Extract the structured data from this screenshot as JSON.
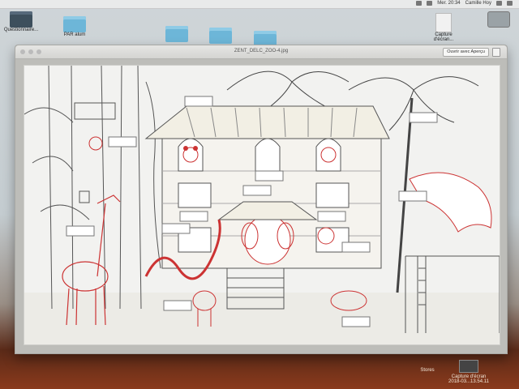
{
  "menubar": {
    "time": "Mer. 20:34",
    "user": "Camille Hoy"
  },
  "desktop": {
    "icons": [
      {
        "label": "Questionnaire..."
      },
      {
        "label": "PAR alum"
      },
      {
        "label": ""
      },
      {
        "label": ""
      },
      {
        "label": ""
      },
      {
        "label": "Capture d'écran..."
      },
      {
        "label": ""
      }
    ]
  },
  "window": {
    "title": "ZENT_DELC_ZOO-4.jpg",
    "open_with_label": "Ouvrir avec Aperçu"
  },
  "taskbar": {
    "stores_label": "Stores",
    "screenshot_label": "Capture d'écran",
    "screenshot_date": "2018-03...13.54.11"
  }
}
